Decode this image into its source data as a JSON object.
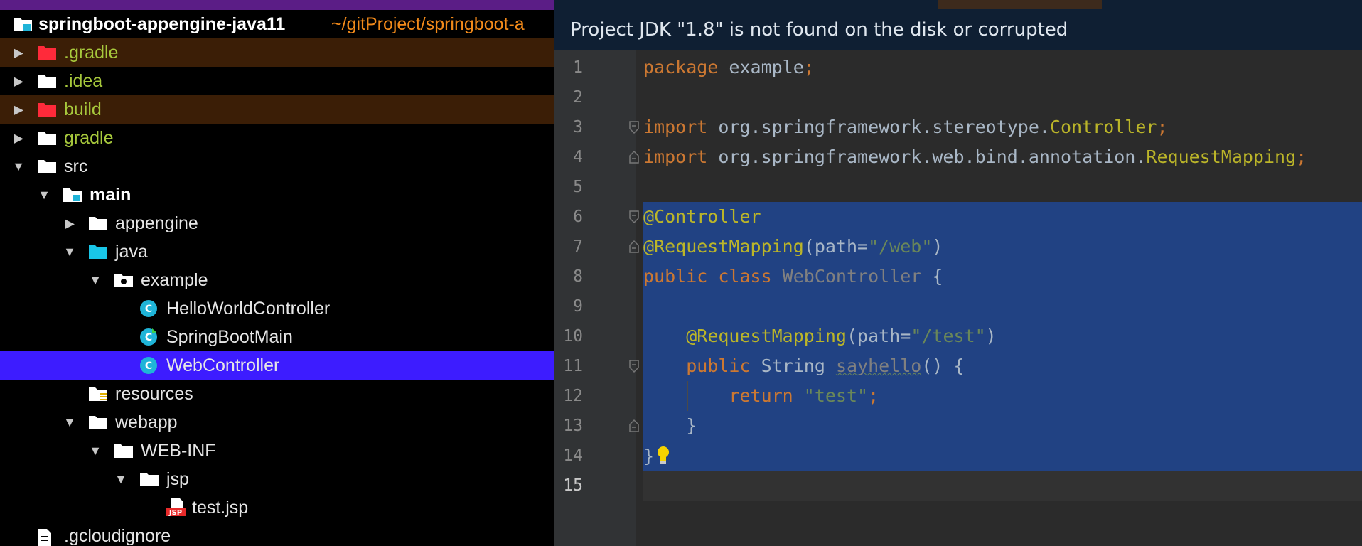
{
  "project": {
    "root_name": "springboot-appengine-java11",
    "root_path": "~/gitProject/springboot-a",
    "items": [
      {
        "label": ".gradle",
        "depth": 1,
        "kind": "folder-excluded",
        "expand": "collapsed",
        "ignored": true
      },
      {
        "label": ".idea",
        "depth": 1,
        "kind": "folder",
        "expand": "collapsed",
        "vcs": "green"
      },
      {
        "label": "build",
        "depth": 1,
        "kind": "folder-excluded",
        "expand": "collapsed",
        "ignored": true
      },
      {
        "label": "gradle",
        "depth": 1,
        "kind": "folder",
        "expand": "collapsed",
        "vcs": "green"
      },
      {
        "label": "src",
        "depth": 1,
        "kind": "folder",
        "expand": "expanded"
      },
      {
        "label": "main",
        "depth": 2,
        "kind": "module-folder",
        "expand": "expanded",
        "bold": true
      },
      {
        "label": "appengine",
        "depth": 3,
        "kind": "folder",
        "expand": "collapsed"
      },
      {
        "label": "java",
        "depth": 3,
        "kind": "source-folder",
        "expand": "expanded"
      },
      {
        "label": "example",
        "depth": 4,
        "kind": "package",
        "expand": "expanded"
      },
      {
        "label": "HelloWorldController",
        "depth": 5,
        "kind": "class",
        "expand": "none"
      },
      {
        "label": "SpringBootMain",
        "depth": 5,
        "kind": "class-main",
        "expand": "none"
      },
      {
        "label": "WebController",
        "depth": 5,
        "kind": "class",
        "expand": "none",
        "selected": true
      },
      {
        "label": "resources",
        "depth": 3,
        "kind": "resources-folder",
        "expand": "none"
      },
      {
        "label": "webapp",
        "depth": 3,
        "kind": "folder",
        "expand": "expanded"
      },
      {
        "label": "WEB-INF",
        "depth": 4,
        "kind": "folder",
        "expand": "expanded"
      },
      {
        "label": "jsp",
        "depth": 5,
        "kind": "folder",
        "expand": "expanded"
      },
      {
        "label": "test.jsp",
        "depth": 6,
        "kind": "jsp-file",
        "expand": "none"
      },
      {
        "label": ".gcloudignore",
        "depth": 1,
        "kind": "file",
        "expand": "none"
      }
    ]
  },
  "editor": {
    "notification": "Project JDK \"1.8\" is not found on the disk or corrupted",
    "caret_line": 15,
    "selection": [
      6,
      14
    ],
    "lines": [
      {
        "n": "1",
        "fold": "",
        "tokens": [
          {
            "t": "package ",
            "c": "kw"
          },
          {
            "t": "example",
            "c": ""
          },
          {
            "t": ";",
            "c": "kw"
          }
        ]
      },
      {
        "n": "2",
        "fold": "",
        "tokens": []
      },
      {
        "n": "3",
        "fold": "open",
        "tokens": [
          {
            "t": "import ",
            "c": "kw"
          },
          {
            "t": "org.springframework.stereotype.",
            "c": ""
          },
          {
            "t": "Controller",
            "c": "ann"
          },
          {
            "t": ";",
            "c": "kw"
          }
        ]
      },
      {
        "n": "4",
        "fold": "close",
        "tokens": [
          {
            "t": "import ",
            "c": "kw"
          },
          {
            "t": "org.springframework.web.bind.annotation.",
            "c": ""
          },
          {
            "t": "RequestMapping",
            "c": "ann"
          },
          {
            "t": ";",
            "c": "kw"
          }
        ]
      },
      {
        "n": "5",
        "fold": "",
        "tokens": []
      },
      {
        "n": "6",
        "fold": "open",
        "tokens": [
          {
            "t": "@Controller",
            "c": "ann"
          }
        ]
      },
      {
        "n": "7",
        "fold": "close",
        "tokens": [
          {
            "t": "@RequestMapping",
            "c": "ann"
          },
          {
            "t": "(path=",
            "c": ""
          },
          {
            "t": "\"/web\"",
            "c": "str"
          },
          {
            "t": ")",
            "c": ""
          }
        ]
      },
      {
        "n": "8",
        "fold": "",
        "tokens": [
          {
            "t": "public class ",
            "c": "kw"
          },
          {
            "t": "WebController",
            "c": "cls-dim"
          },
          {
            "t": " {",
            "c": ""
          }
        ]
      },
      {
        "n": "9",
        "fold": "",
        "tokens": []
      },
      {
        "n": "10",
        "fold": "",
        "tokens": [
          {
            "t": "    ",
            "c": ""
          },
          {
            "t": "@RequestMapping",
            "c": "ann"
          },
          {
            "t": "(path=",
            "c": ""
          },
          {
            "t": "\"/test\"",
            "c": "str"
          },
          {
            "t": ")",
            "c": ""
          }
        ]
      },
      {
        "n": "11",
        "fold": "open",
        "tokens": [
          {
            "t": "    ",
            "c": ""
          },
          {
            "t": "public ",
            "c": "kw"
          },
          {
            "t": "String ",
            "c": ""
          },
          {
            "t": "sayhello",
            "c": "typo"
          },
          {
            "t": "() {",
            "c": ""
          }
        ]
      },
      {
        "n": "12",
        "fold": "",
        "tokens": [
          {
            "t": "        ",
            "c": ""
          },
          {
            "t": "return ",
            "c": "kw"
          },
          {
            "t": "\"test\"",
            "c": "str"
          },
          {
            "t": ";",
            "c": "kw"
          }
        ]
      },
      {
        "n": "13",
        "fold": "close",
        "tokens": [
          {
            "t": "    }",
            "c": ""
          }
        ]
      },
      {
        "n": "14",
        "fold": "",
        "tokens": [
          {
            "t": "}",
            "c": ""
          }
        ],
        "bulb": true
      },
      {
        "n": "15",
        "fold": "",
        "tokens": []
      }
    ]
  },
  "colors": {
    "selection": "#214283",
    "tree_selected": "#3d1cff",
    "ignored_row": "#3b1e06",
    "keyword": "#cc7832",
    "annotation": "#bbb529",
    "string": "#6a8759"
  },
  "icons": {
    "folder": "folder-icon",
    "folder-excluded": "excluded-folder-icon",
    "module-folder": "module-folder-icon",
    "source-folder": "source-folder-icon",
    "package": "package-icon",
    "class": "java-class-icon",
    "class-main": "java-main-class-icon",
    "resources-folder": "resources-folder-icon",
    "jsp-file": "jsp-file-icon",
    "file": "file-icon",
    "bulb": "lightbulb-icon"
  }
}
